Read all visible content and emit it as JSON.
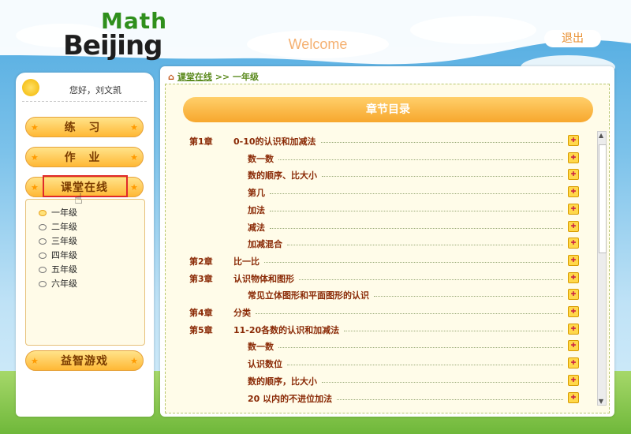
{
  "brand": {
    "math": "Math",
    "beijing": "Beijing"
  },
  "header": {
    "welcome": "Welcome",
    "logout": "退出"
  },
  "user": {
    "greeting": "您好，刘文凯"
  },
  "nav": {
    "practice": "练 习",
    "homework": "作 业",
    "classroom": "课堂在线",
    "games": "益智游戏"
  },
  "grades": [
    "一年级",
    "二年级",
    "三年级",
    "四年级",
    "五年级",
    "六年级"
  ],
  "breadcrumb": {
    "root": "课堂在线",
    "sep": ">>",
    "current": "一年级"
  },
  "toc": {
    "header": "章节目录",
    "rows": [
      {
        "chapter": "第1章",
        "title": "0-10的认识和加减法"
      },
      {
        "chapter": "",
        "title": "数一数"
      },
      {
        "chapter": "",
        "title": "数的顺序、比大小"
      },
      {
        "chapter": "",
        "title": "第几"
      },
      {
        "chapter": "",
        "title": "加法"
      },
      {
        "chapter": "",
        "title": "减法"
      },
      {
        "chapter": "",
        "title": "加减混合"
      },
      {
        "chapter": "第2章",
        "title": "比一比"
      },
      {
        "chapter": "第3章",
        "title": "认识物体和图形"
      },
      {
        "chapter": "",
        "title": "常见立体图形和平面图形的认识"
      },
      {
        "chapter": "第4章",
        "title": "分类"
      },
      {
        "chapter": "第5章",
        "title": "11-20各数的认识和加减法"
      },
      {
        "chapter": "",
        "title": "数一数"
      },
      {
        "chapter": "",
        "title": "认识数位"
      },
      {
        "chapter": "",
        "title": "数的顺序，比大小"
      },
      {
        "chapter": "",
        "title": "20 以内的不进位加法"
      }
    ]
  },
  "icons": {
    "gift": "gift-icon",
    "home": "home-icon",
    "star": "star-icon",
    "sun": "sun-avatar-icon"
  }
}
